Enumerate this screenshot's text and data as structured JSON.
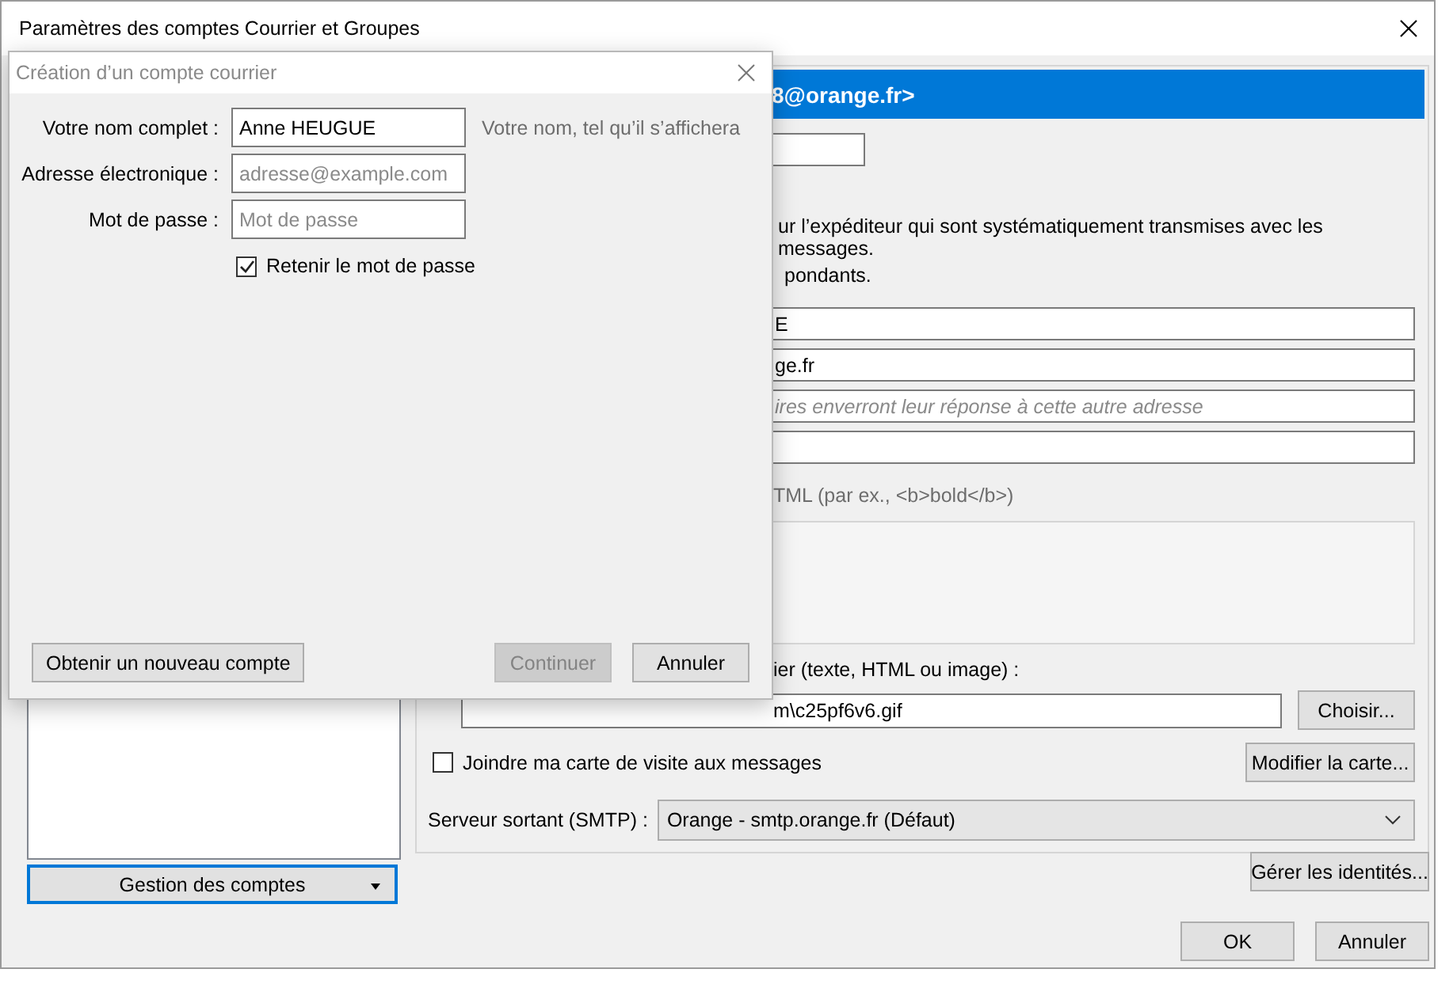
{
  "window": {
    "title": "Paramètres des comptes Courrier et Groupes"
  },
  "account_list": {
    "button": "Gestion des comptes"
  },
  "account_panel": {
    "header": "8@orange.fr>",
    "intro": [
      "ur l’expéditeur qui sont systématiquement transmises avec les messages.",
      "pondants."
    ],
    "fields": [
      {
        "value": "E"
      },
      {
        "value": "ge.fr"
      },
      {
        "placeholder": "ires enverront leur réponse à cette autre adresse"
      }
    ],
    "html_hint": "TML (par ex., <b>bold</b>)",
    "signature_label": "ier (texte, HTML ou image) :",
    "signature_file": "m\\c25pf6v6.gif",
    "choose_button": "Choisir...",
    "vcard": {
      "label": "Joindre ma carte de visite aux messages",
      "checked": false
    },
    "edit_card_button": "Modifier la carte...",
    "smtp": {
      "label": "Serveur sortant (SMTP) :",
      "value": "Orange - smtp.orange.fr (Défaut)"
    }
  },
  "manage_identities_button": "Gérer les identités...",
  "buttons": [
    "OK",
    "Annuler"
  ],
  "dialog": {
    "title": "Création d’un compte courrier",
    "fields": [
      {
        "label": "Votre nom complet :",
        "value": "Anne HEUGUE",
        "hint": "Votre nom, tel qu’il s’affichera"
      },
      {
        "label": "Adresse électronique :",
        "placeholder": "adresse@example.com"
      },
      {
        "label": "Mot de passe :",
        "placeholder": "Mot de passe"
      }
    ],
    "remember": {
      "label": "Retenir le mot de passe",
      "checked": true
    },
    "get_account_button": "Obtenir un nouveau compte",
    "continue_button": {
      "label": "Continuer",
      "disabled": true
    },
    "cancel_button": "Annuler"
  }
}
